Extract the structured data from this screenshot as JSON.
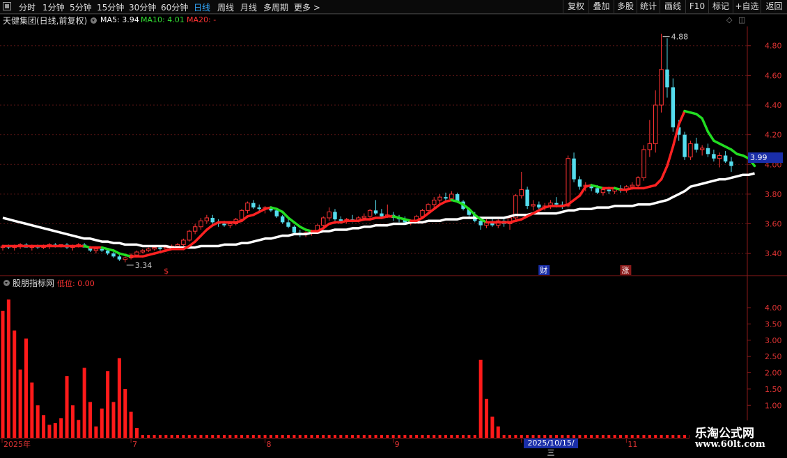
{
  "toolbar": {
    "periods": [
      "分时",
      "1分钟",
      "5分钟",
      "15分钟",
      "30分钟",
      "60分钟",
      "日线",
      "周线",
      "月线",
      "多周期",
      "更多 >"
    ],
    "active_period": "日线",
    "right_buttons": [
      "复权",
      "叠加",
      "多股",
      "统计",
      "画线",
      "F10",
      "标记",
      "+自选",
      "返回"
    ]
  },
  "main_info": {
    "stock_label": "天健集团(日线,前复权)",
    "ma5_label": "MA5: 3.94",
    "ma10_label": "MA10: 4.01",
    "ma20_label": "MA20: -",
    "colors": {
      "ma5": "#ffffff",
      "ma10": "#33dd33",
      "ma20": "#ff3333"
    }
  },
  "indicator_info": {
    "name": "股朋指标网",
    "value_label": "低位: 0.00"
  },
  "price_tag": "3.99",
  "date_tag": "2025/10/15/三",
  "markers": {
    "low_label": "3.34",
    "high_label": "4.88",
    "s_marker": "$",
    "cai_marker": "财",
    "zhang_marker": "涨"
  },
  "watermark": {
    "line1": "乐淘公式网",
    "line2": "www.60lt.com"
  },
  "chart_data": [
    {
      "type": "candlestick",
      "y_ticks": [
        "4.80",
        "4.60",
        "4.40",
        "4.20",
        "4.00",
        "3.80",
        "3.60",
        "3.40"
      ],
      "ylim": [
        3.26,
        4.93
      ],
      "colors": {
        "up": "#ff3333",
        "down": "#55ddee",
        "ma_bull": "#ff2222",
        "ma_bear": "#22dd22",
        "ma_long": "#ffffff"
      },
      "candles": [
        [
          3.44,
          3.46,
          3.42,
          3.45
        ],
        [
          3.45,
          3.46,
          3.43,
          3.44
        ],
        [
          3.44,
          3.46,
          3.42,
          3.45
        ],
        [
          3.45,
          3.47,
          3.43,
          3.46
        ],
        [
          3.46,
          3.47,
          3.44,
          3.44
        ],
        [
          3.44,
          3.46,
          3.42,
          3.45
        ],
        [
          3.45,
          3.46,
          3.43,
          3.44
        ],
        [
          3.44,
          3.46,
          3.43,
          3.45
        ],
        [
          3.45,
          3.47,
          3.43,
          3.46
        ],
        [
          3.46,
          3.47,
          3.44,
          3.45
        ],
        [
          3.45,
          3.46,
          3.44,
          3.46
        ],
        [
          3.46,
          3.47,
          3.43,
          3.44
        ],
        [
          3.44,
          3.46,
          3.42,
          3.45
        ],
        [
          3.45,
          3.47,
          3.44,
          3.46
        ],
        [
          3.46,
          3.47,
          3.44,
          3.44
        ],
        [
          3.44,
          3.45,
          3.41,
          3.42
        ],
        [
          3.42,
          3.44,
          3.4,
          3.43
        ],
        [
          3.43,
          3.44,
          3.41,
          3.42
        ],
        [
          3.42,
          3.43,
          3.39,
          3.4
        ],
        [
          3.4,
          3.41,
          3.37,
          3.38
        ],
        [
          3.38,
          3.39,
          3.35,
          3.36
        ],
        [
          3.36,
          3.38,
          3.34,
          3.37
        ],
        [
          3.37,
          3.4,
          3.36,
          3.39
        ],
        [
          3.39,
          3.42,
          3.38,
          3.41
        ],
        [
          3.41,
          3.43,
          3.4,
          3.42
        ],
        [
          3.42,
          3.44,
          3.41,
          3.43
        ],
        [
          3.43,
          3.45,
          3.42,
          3.44
        ],
        [
          3.44,
          3.45,
          3.42,
          3.43
        ],
        [
          3.43,
          3.45,
          3.42,
          3.44
        ],
        [
          3.44,
          3.46,
          3.43,
          3.45
        ],
        [
          3.45,
          3.47,
          3.44,
          3.46
        ],
        [
          3.46,
          3.5,
          3.45,
          3.49
        ],
        [
          3.49,
          3.56,
          3.48,
          3.55
        ],
        [
          3.55,
          3.6,
          3.53,
          3.58
        ],
        [
          3.58,
          3.64,
          3.56,
          3.62
        ],
        [
          3.62,
          3.66,
          3.6,
          3.64
        ],
        [
          3.64,
          3.66,
          3.6,
          3.61
        ],
        [
          3.61,
          3.63,
          3.58,
          3.6
        ],
        [
          3.6,
          3.62,
          3.58,
          3.59
        ],
        [
          3.59,
          3.61,
          3.57,
          3.6
        ],
        [
          3.6,
          3.64,
          3.59,
          3.63
        ],
        [
          3.63,
          3.7,
          3.62,
          3.69
        ],
        [
          3.69,
          3.75,
          3.67,
          3.74
        ],
        [
          3.74,
          3.76,
          3.7,
          3.71
        ],
        [
          3.71,
          3.73,
          3.68,
          3.7
        ],
        [
          3.7,
          3.72,
          3.67,
          3.71
        ],
        [
          3.71,
          3.72,
          3.68,
          3.69
        ],
        [
          3.69,
          3.7,
          3.64,
          3.65
        ],
        [
          3.65,
          3.66,
          3.6,
          3.61
        ],
        [
          3.61,
          3.63,
          3.57,
          3.58
        ],
        [
          3.58,
          3.59,
          3.53,
          3.54
        ],
        [
          3.54,
          3.56,
          3.51,
          3.53
        ],
        [
          3.53,
          3.55,
          3.51,
          3.54
        ],
        [
          3.54,
          3.56,
          3.52,
          3.55
        ],
        [
          3.55,
          3.6,
          3.54,
          3.59
        ],
        [
          3.59,
          3.65,
          3.58,
          3.64
        ],
        [
          3.64,
          3.71,
          3.62,
          3.68
        ],
        [
          3.68,
          3.7,
          3.62,
          3.63
        ],
        [
          3.63,
          3.65,
          3.6,
          3.62
        ],
        [
          3.62,
          3.64,
          3.6,
          3.63
        ],
        [
          3.63,
          3.66,
          3.61,
          3.62
        ],
        [
          3.62,
          3.65,
          3.61,
          3.64
        ],
        [
          3.64,
          3.67,
          3.62,
          3.65
        ],
        [
          3.65,
          3.7,
          3.63,
          3.69
        ],
        [
          3.69,
          3.76,
          3.66,
          3.67
        ],
        [
          3.67,
          3.7,
          3.64,
          3.65
        ],
        [
          3.65,
          3.73,
          3.64,
          3.66
        ],
        [
          3.66,
          3.68,
          3.62,
          3.64
        ],
        [
          3.64,
          3.66,
          3.61,
          3.63
        ],
        [
          3.63,
          3.65,
          3.6,
          3.61
        ],
        [
          3.61,
          3.63,
          3.59,
          3.62
        ],
        [
          3.62,
          3.66,
          3.61,
          3.65
        ],
        [
          3.65,
          3.7,
          3.63,
          3.69
        ],
        [
          3.69,
          3.74,
          3.67,
          3.73
        ],
        [
          3.73,
          3.78,
          3.71,
          3.76
        ],
        [
          3.76,
          3.8,
          3.74,
          3.78
        ],
        [
          3.78,
          3.81,
          3.75,
          3.77
        ],
        [
          3.77,
          3.82,
          3.75,
          3.8
        ],
        [
          3.8,
          3.81,
          3.74,
          3.75
        ],
        [
          3.75,
          3.76,
          3.69,
          3.7
        ],
        [
          3.7,
          3.71,
          3.64,
          3.66
        ],
        [
          3.66,
          3.68,
          3.61,
          3.62
        ],
        [
          3.62,
          3.64,
          3.56,
          3.59
        ],
        [
          3.59,
          3.63,
          3.57,
          3.61
        ],
        [
          3.61,
          3.64,
          3.58,
          3.59
        ],
        [
          3.59,
          3.63,
          3.57,
          3.62
        ],
        [
          3.62,
          3.64,
          3.58,
          3.6
        ],
        [
          3.6,
          3.66,
          3.56,
          3.64
        ],
        [
          3.64,
          3.8,
          3.62,
          3.79
        ],
        [
          3.79,
          3.95,
          3.77,
          3.83
        ],
        [
          3.83,
          3.85,
          3.7,
          3.72
        ],
        [
          3.72,
          3.76,
          3.69,
          3.73
        ],
        [
          3.73,
          3.75,
          3.7,
          3.71
        ],
        [
          3.71,
          3.74,
          3.69,
          3.72
        ],
        [
          3.72,
          3.76,
          3.7,
          3.74
        ],
        [
          3.74,
          3.78,
          3.71,
          3.73
        ],
        [
          3.73,
          3.75,
          3.7,
          3.72
        ],
        [
          3.72,
          4.06,
          3.71,
          4.04
        ],
        [
          4.04,
          4.08,
          3.88,
          3.9
        ],
        [
          3.9,
          3.92,
          3.83,
          3.85
        ],
        [
          3.85,
          3.88,
          3.82,
          3.86
        ],
        [
          3.86,
          3.87,
          3.82,
          3.84
        ],
        [
          3.84,
          3.86,
          3.8,
          3.81
        ],
        [
          3.81,
          3.84,
          3.79,
          3.83
        ],
        [
          3.83,
          3.85,
          3.8,
          3.82
        ],
        [
          3.82,
          3.85,
          3.8,
          3.84
        ],
        [
          3.84,
          3.86,
          3.81,
          3.83
        ],
        [
          3.83,
          3.86,
          3.81,
          3.85
        ],
        [
          3.85,
          3.88,
          3.83,
          3.86
        ],
        [
          3.86,
          3.92,
          3.84,
          3.91
        ],
        [
          3.91,
          4.13,
          3.89,
          4.1
        ],
        [
          4.1,
          4.3,
          4.05,
          4.14
        ],
        [
          4.14,
          4.5,
          4.08,
          4.4
        ],
        [
          4.4,
          4.88,
          4.35,
          4.64
        ],
        [
          4.64,
          4.85,
          4.45,
          4.52
        ],
        [
          4.52,
          4.58,
          4.22,
          4.25
        ],
        [
          4.25,
          4.3,
          4.16,
          4.2
        ],
        [
          4.2,
          4.22,
          4.03,
          4.05
        ],
        [
          4.05,
          4.16,
          4.03,
          4.14
        ],
        [
          4.14,
          4.18,
          4.08,
          4.1
        ],
        [
          4.1,
          4.13,
          4.06,
          4.11
        ],
        [
          4.11,
          4.14,
          4.05,
          4.07
        ],
        [
          4.07,
          4.1,
          4.02,
          4.04
        ],
        [
          4.04,
          4.08,
          3.98,
          4.06
        ],
        [
          4.06,
          4.09,
          4.01,
          4.02
        ],
        [
          4.02,
          4.05,
          3.95,
          3.99
        ]
      ],
      "ma_short": [
        3.45,
        3.45,
        3.45,
        3.45,
        3.45,
        3.45,
        3.45,
        3.45,
        3.45,
        3.45,
        3.45,
        3.45,
        3.45,
        3.45,
        3.45,
        3.44,
        3.44,
        3.44,
        3.43,
        3.42,
        3.4,
        3.39,
        3.38,
        3.38,
        3.38,
        3.39,
        3.4,
        3.41,
        3.42,
        3.43,
        3.43,
        3.43,
        3.45,
        3.48,
        3.52,
        3.56,
        3.59,
        3.61,
        3.61,
        3.61,
        3.61,
        3.62,
        3.65,
        3.66,
        3.68,
        3.7,
        3.71,
        3.7,
        3.68,
        3.64,
        3.61,
        3.58,
        3.56,
        3.55,
        3.55,
        3.57,
        3.6,
        3.61,
        3.61,
        3.62,
        3.62,
        3.62,
        3.63,
        3.63,
        3.64,
        3.64,
        3.65,
        3.65,
        3.64,
        3.63,
        3.62,
        3.62,
        3.64,
        3.67,
        3.7,
        3.73,
        3.75,
        3.76,
        3.75,
        3.73,
        3.7,
        3.66,
        3.63,
        3.61,
        3.61,
        3.61,
        3.61,
        3.61,
        3.62,
        3.63,
        3.65,
        3.67,
        3.69,
        3.71,
        3.72,
        3.72,
        3.72,
        3.73,
        3.76,
        3.79,
        3.85,
        3.86,
        3.85,
        3.84,
        3.84,
        3.84,
        3.83,
        3.83,
        3.84,
        3.84,
        3.84,
        3.85,
        3.86,
        3.9,
        3.99,
        4.12,
        4.27,
        4.36,
        4.35,
        4.34,
        4.31,
        4.22,
        4.16,
        4.14,
        4.12,
        4.1,
        4.07,
        4.06,
        4.04,
        3.99
      ],
      "ma_long": [
        3.64,
        3.63,
        3.62,
        3.61,
        3.6,
        3.59,
        3.58,
        3.57,
        3.56,
        3.55,
        3.54,
        3.53,
        3.52,
        3.51,
        3.5,
        3.5,
        3.49,
        3.48,
        3.48,
        3.47,
        3.47,
        3.46,
        3.46,
        3.46,
        3.45,
        3.45,
        3.45,
        3.45,
        3.45,
        3.44,
        3.44,
        3.44,
        3.44,
        3.44,
        3.45,
        3.45,
        3.45,
        3.45,
        3.46,
        3.46,
        3.46,
        3.47,
        3.47,
        3.48,
        3.49,
        3.5,
        3.5,
        3.51,
        3.52,
        3.52,
        3.53,
        3.53,
        3.53,
        3.54,
        3.54,
        3.55,
        3.55,
        3.56,
        3.56,
        3.56,
        3.57,
        3.57,
        3.58,
        3.58,
        3.59,
        3.59,
        3.59,
        3.6,
        3.6,
        3.6,
        3.61,
        3.61,
        3.61,
        3.62,
        3.62,
        3.62,
        3.63,
        3.63,
        3.63,
        3.64,
        3.64,
        3.64,
        3.64,
        3.64,
        3.64,
        3.64,
        3.64,
        3.65,
        3.66,
        3.66,
        3.66,
        3.67,
        3.67,
        3.67,
        3.67,
        3.67,
        3.68,
        3.69,
        3.69,
        3.7,
        3.7,
        3.7,
        3.71,
        3.71,
        3.71,
        3.72,
        3.72,
        3.72,
        3.72,
        3.73,
        3.73,
        3.73,
        3.74,
        3.75,
        3.76,
        3.78,
        3.8,
        3.82,
        3.85,
        3.86,
        3.87,
        3.88,
        3.89,
        3.9,
        3.9,
        3.91,
        3.92,
        3.93,
        3.93,
        3.94
      ]
    },
    {
      "type": "bar",
      "y_ticks": [
        "4.00",
        "3.50",
        "3.00",
        "2.50",
        "2.00",
        "1.50",
        "1.00"
      ],
      "ylim": [
        0,
        4.6
      ],
      "x_labels": [
        {
          "label": "2025年",
          "i": 0
        },
        {
          "label": "7",
          "i": 22
        },
        {
          "label": "8",
          "i": 45
        },
        {
          "label": "9",
          "i": 67
        },
        {
          "label": "10",
          "i": 89
        },
        {
          "label": "11",
          "i": 107
        }
      ],
      "values": [
        3.9,
        4.25,
        3.3,
        2.1,
        3.05,
        1.7,
        1.0,
        0.7,
        0.4,
        0.45,
        0.6,
        1.9,
        1.0,
        0.55,
        2.15,
        1.1,
        0.35,
        0.9,
        2.05,
        1.1,
        2.45,
        1.5,
        0.8,
        0.3,
        0.15,
        0.1,
        0.1,
        0.1,
        0.1,
        0.1,
        0.1,
        0.1,
        0.1,
        0.1,
        0.1,
        0.1,
        0.1,
        0.1,
        0.1,
        0.1,
        0.1,
        0.1,
        0.1,
        0.1,
        0.1,
        0.1,
        0.1,
        0.1,
        0.1,
        0.1,
        0.1,
        0.1,
        0.1,
        0.1,
        0.1,
        0.1,
        0.1,
        0.1,
        0.1,
        0.1,
        0.1,
        0.1,
        0.1,
        0.1,
        0.1,
        0.1,
        0.1,
        0.1,
        0.1,
        0.1,
        0.1,
        0.1,
        0.1,
        0.1,
        0.1,
        0.1,
        0.1,
        0.1,
        0.1,
        0.1,
        0.1,
        0.1,
        2.4,
        1.2,
        0.65,
        0.35,
        0.2,
        0.15,
        0.1,
        0.1,
        0.1,
        0.1,
        0.1,
        0.1,
        0.1,
        0.1,
        0.1,
        0.1,
        0.1,
        0.1,
        0.1,
        0.1,
        0.1,
        0.1,
        0.1,
        0.1,
        0.1,
        0.1,
        0.1,
        0.1,
        0.1,
        0.1,
        0.1,
        0.1,
        0.1,
        0.1,
        0.1,
        0.1,
        0.1,
        0.1
      ]
    }
  ]
}
